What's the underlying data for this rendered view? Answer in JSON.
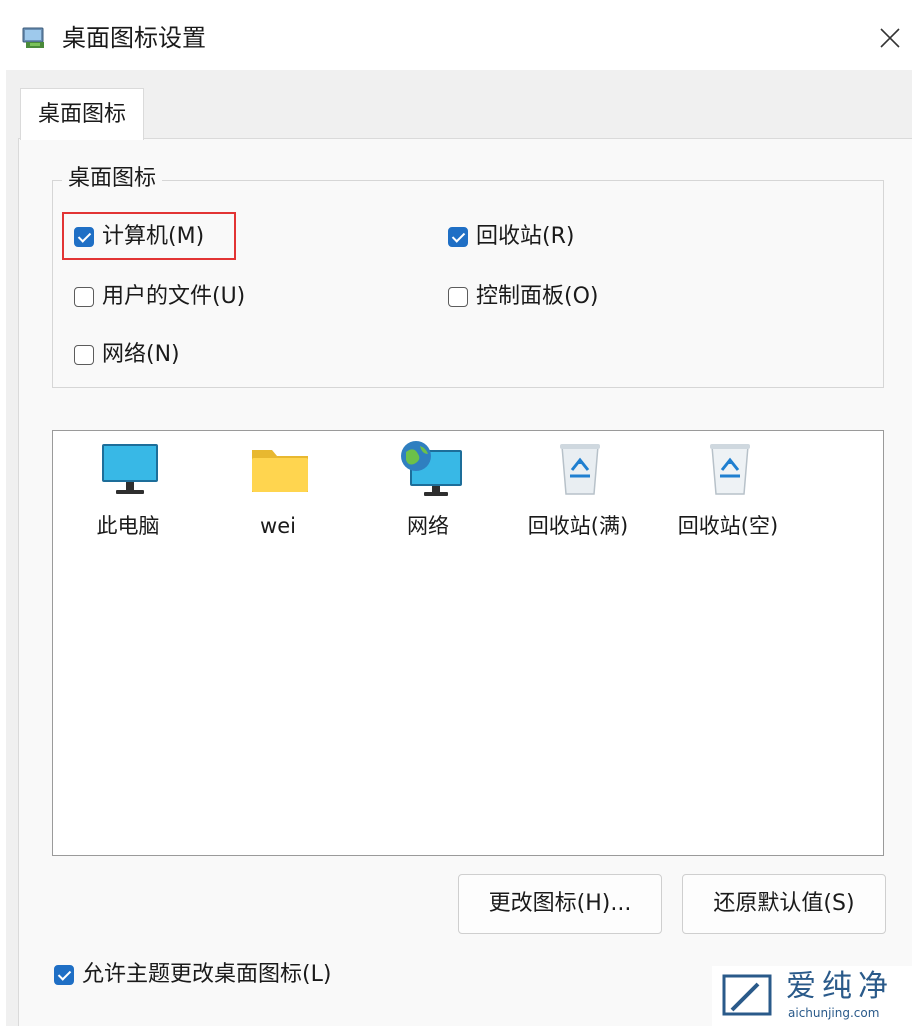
{
  "window": {
    "title": "桌面图标设置",
    "close_glyph": "✕"
  },
  "tabs": [
    {
      "label": "桌面图标",
      "active": true
    }
  ],
  "group": {
    "label": "桌面图标",
    "checkboxes": [
      {
        "label": "计算机(M)",
        "checked": true,
        "highlighted": true
      },
      {
        "label": "回收站(R)",
        "checked": true
      },
      {
        "label": "用户的文件(U)",
        "checked": false
      },
      {
        "label": "控制面板(O)",
        "checked": false
      },
      {
        "label": "网络(N)",
        "checked": false
      }
    ]
  },
  "icons": [
    {
      "label": "此电脑",
      "icon": "monitor-icon"
    },
    {
      "label": "wei",
      "icon": "folder-icon"
    },
    {
      "label": "网络",
      "icon": "network-globe-icon"
    },
    {
      "label": "回收站(满)",
      "icon": "recycle-bin-full-icon"
    },
    {
      "label": "回收站(空)",
      "icon": "recycle-bin-empty-icon"
    }
  ],
  "buttons": {
    "change_icon": "更改图标(H)...",
    "restore_default": "还原默认值(S)"
  },
  "allow_themes": {
    "label": "允许主题更改桌面图标(L)",
    "checked": true
  },
  "watermark": {
    "text": "爱纯净",
    "sub": "aichunjing.com"
  },
  "colors": {
    "accent": "#1f6fc5",
    "highlight_border": "#e23434",
    "watermark": "#2a5a8a"
  }
}
